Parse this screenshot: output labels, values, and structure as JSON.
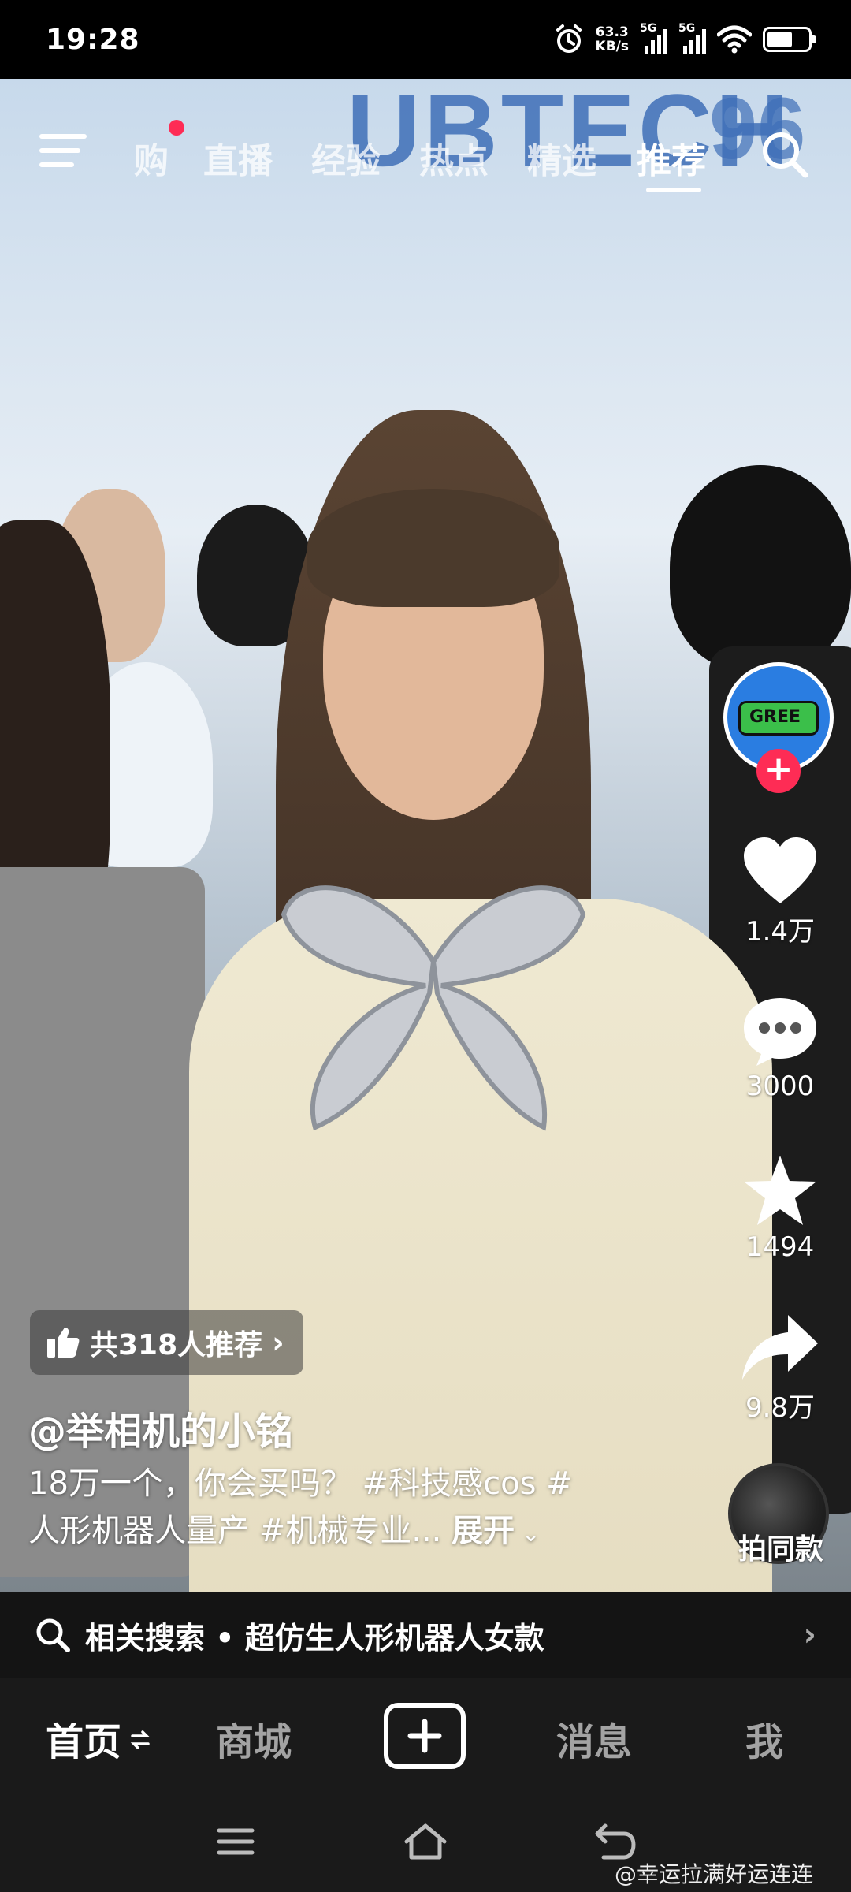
{
  "status_bar": {
    "time": "19:28",
    "net_speed_value": "63.3",
    "net_speed_unit": "KB/s",
    "sim1": "5G",
    "sim2": "5G"
  },
  "background": {
    "brand_text": "UBTECH",
    "brand_text_2": "96"
  },
  "top_tabs": {
    "items": [
      "购",
      "直播",
      "经验",
      "热点",
      "精选",
      "推荐"
    ],
    "active": "推荐"
  },
  "right_rail": {
    "avatar_text": "GREE",
    "like_count": "1.4万",
    "comment_count": "3000",
    "favorite_count": "1494",
    "share_count": "9.8万",
    "same_style_label": "拍同款"
  },
  "recommend_chip": {
    "label": "共318人推荐"
  },
  "caption": {
    "author": "@举相机的小铭",
    "line1": "18万一个，你会买吗？ #科技感cos #",
    "line2": "人形机器人量产 #机械专业... ",
    "expand": "展开"
  },
  "related_search": {
    "label": "相关搜索 • 超仿生人形机器人女款"
  },
  "bottom_nav": {
    "home": "首页",
    "mall": "商城",
    "messages": "消息",
    "me": "我"
  },
  "watermark": "@幸运拉满好运连连",
  "colors": {
    "accent": "#fe2c55",
    "bar_background": "#1a1a1a"
  }
}
